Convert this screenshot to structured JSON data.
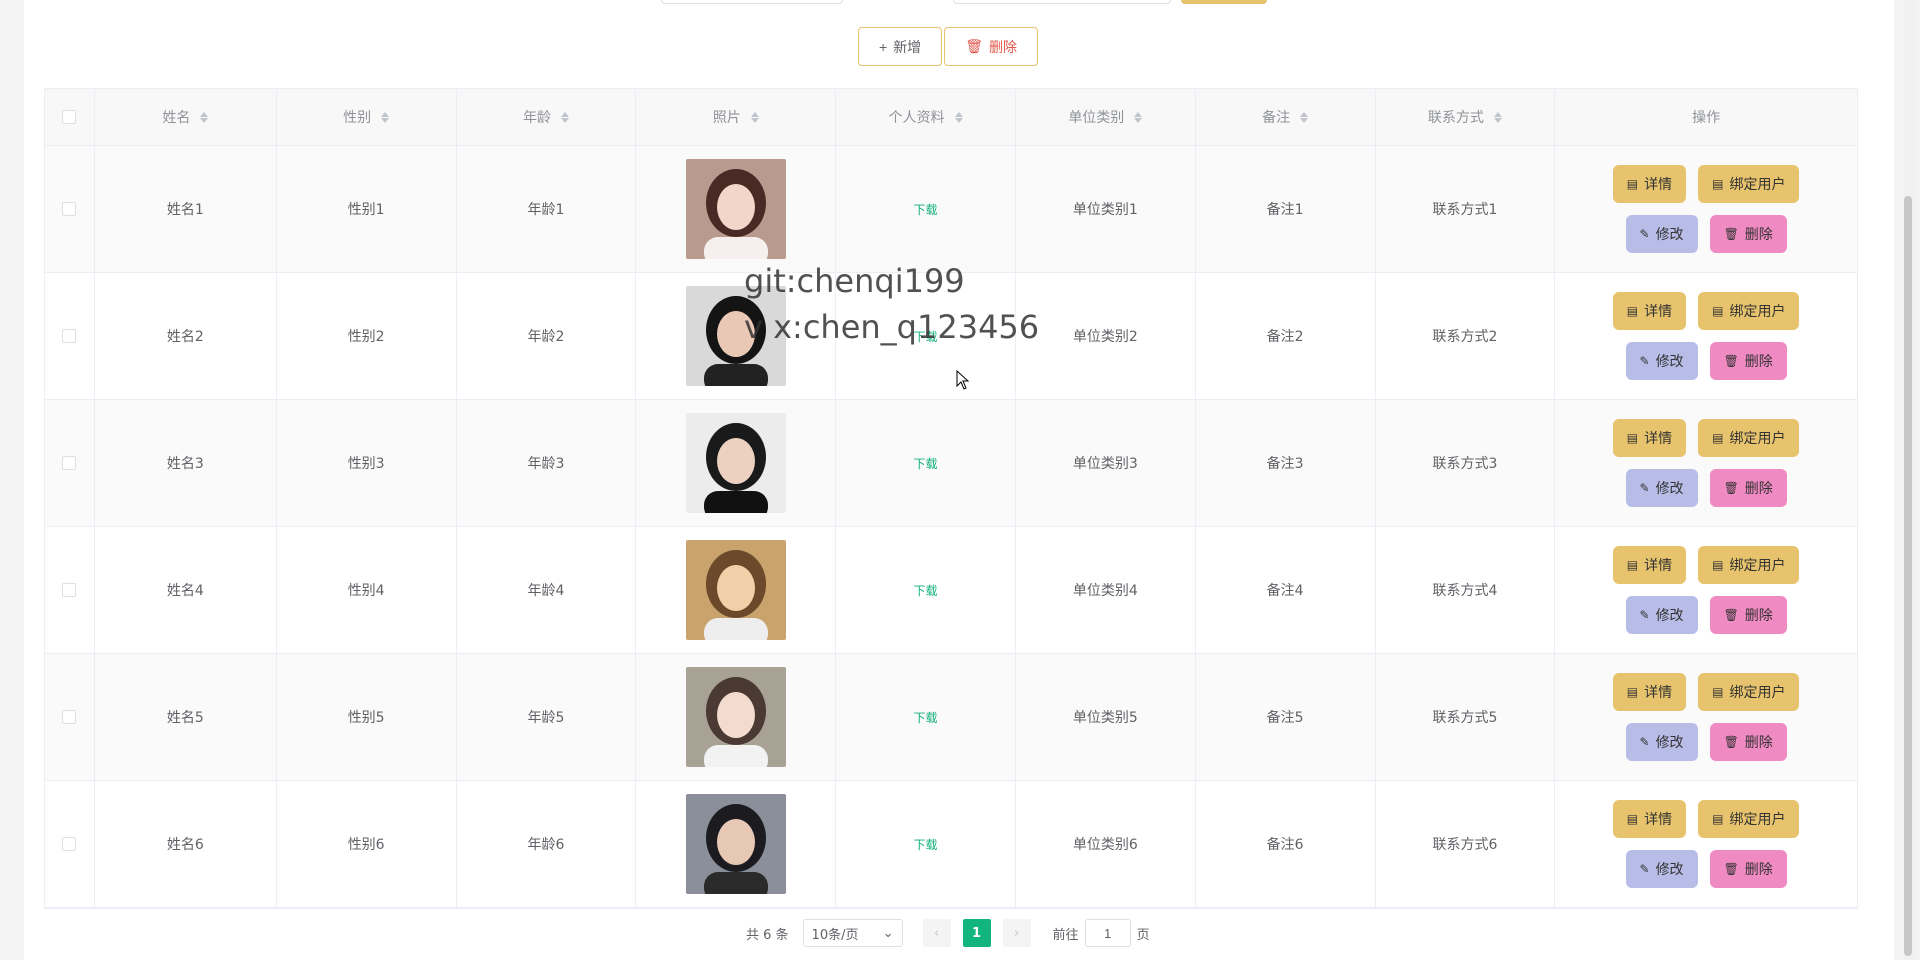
{
  "toolbar": {
    "add_label": "新增",
    "delete_label": "删除"
  },
  "table": {
    "headers": [
      "姓名",
      "性别",
      "年龄",
      "照片",
      "个人资料",
      "单位类别",
      "备注",
      "联系方式",
      "操作"
    ],
    "rows": [
      {
        "name": "姓名1",
        "gender": "性别1",
        "age": "年龄1",
        "file": "下载",
        "unit": "单位类别1",
        "note": "备注1",
        "contact": "联系方式1"
      },
      {
        "name": "姓名2",
        "gender": "性别2",
        "age": "年龄2",
        "file": "下载",
        "unit": "单位类别2",
        "note": "备注2",
        "contact": "联系方式2"
      },
      {
        "name": "姓名3",
        "gender": "性别3",
        "age": "年龄3",
        "file": "下载",
        "unit": "单位类别3",
        "note": "备注3",
        "contact": "联系方式3"
      },
      {
        "name": "姓名4",
        "gender": "性别4",
        "age": "年龄4",
        "file": "下载",
        "unit": "单位类别4",
        "note": "备注4",
        "contact": "联系方式4"
      },
      {
        "name": "姓名5",
        "gender": "性别5",
        "age": "年龄5",
        "file": "下载",
        "unit": "单位类别5",
        "note": "备注5",
        "contact": "联系方式5"
      },
      {
        "name": "姓名6",
        "gender": "性别6",
        "age": "年龄6",
        "file": "下载",
        "unit": "单位类别6",
        "note": "备注6",
        "contact": "联系方式6"
      }
    ],
    "row_actions": {
      "detail": "详情",
      "bind_user": "绑定用户",
      "edit": "修改",
      "delete": "删除"
    }
  },
  "pagination": {
    "total": "共 6 条",
    "page_size": "10条/页",
    "current_page": "1",
    "goto_prefix": "前往",
    "goto_value": "1",
    "goto_suffix": "页"
  },
  "watermark": {
    "line1": "git:chenqi199",
    "line2": "v x:chen_q123456"
  },
  "colors": {
    "accent": "#13b57e",
    "gold": "#e6c36c",
    "edit": "#b8bde8",
    "delete": "#f08ac2"
  }
}
